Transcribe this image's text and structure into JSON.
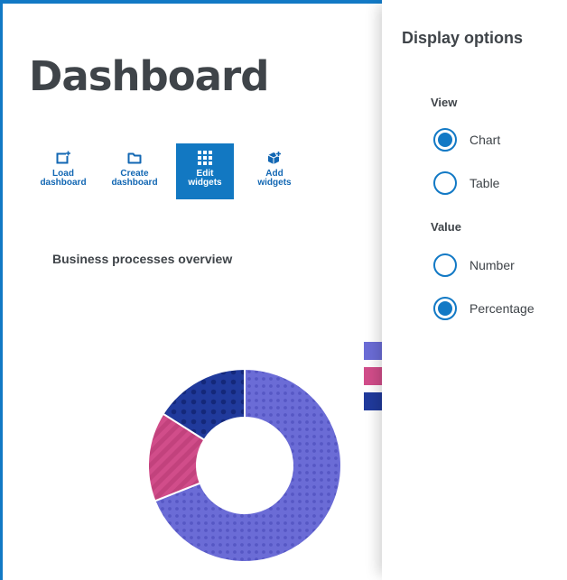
{
  "page": {
    "title": "Dashboard"
  },
  "toolbar": {
    "buttons": [
      {
        "label": "Load\ndashboard",
        "icon": "add-dashboard-icon",
        "active": false
      },
      {
        "label": "Create\ndashboard",
        "icon": "folder-icon",
        "active": false
      },
      {
        "label": "Edit\nwidgets",
        "icon": "grid-icon",
        "active": true
      },
      {
        "label": "Add\nwidgets",
        "icon": "add-cube-icon",
        "active": false
      }
    ]
  },
  "widget": {
    "title": "Business processes overview",
    "chart_data": {
      "type": "pie",
      "donut": true,
      "values": [
        69,
        15,
        16
      ],
      "colors": [
        "#6b6cd6",
        "#d14d8a",
        "#203a9c"
      ],
      "pattern": [
        "dots",
        "stripes",
        "dots"
      ]
    }
  },
  "panel": {
    "title": "Display options",
    "view": {
      "label": "View",
      "options": [
        {
          "label": "Chart",
          "checked": true
        },
        {
          "label": "Table",
          "checked": false
        }
      ]
    },
    "value": {
      "label": "Value",
      "options": [
        {
          "label": "Number",
          "checked": false
        },
        {
          "label": "Percentage",
          "checked": true
        }
      ]
    }
  },
  "colors": {
    "accent": "#1279c5",
    "text": "#3f4449"
  }
}
